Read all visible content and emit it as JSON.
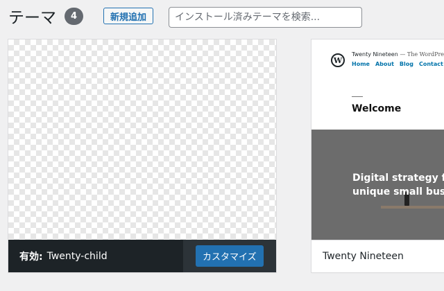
{
  "header": {
    "title": "テーマ",
    "count": "4",
    "add_new_label": "新規追加",
    "search_placeholder": "インストール済みテーマを検索..."
  },
  "themes": [
    {
      "active_label": "有効:",
      "name": "Twenty-child",
      "customize_label": "カスタマイズ"
    },
    {
      "name": "Twenty Nineteen",
      "preview": {
        "site_title": "Twenty Nineteen",
        "site_tagline": "— The WordPress def",
        "nav": [
          "Home",
          "About",
          "Blog",
          "Contact"
        ],
        "heading": "Welcome",
        "hero_line1": "Digital strategy fo",
        "hero_line2": "unique small busin"
      }
    }
  ],
  "colors": {
    "accent": "#2271b1",
    "active_bar": "#1d2327",
    "count_badge": "#646970",
    "background": "#f0f0f1"
  },
  "icons": {
    "wordpress_logo": "wordpress-logo-icon"
  }
}
